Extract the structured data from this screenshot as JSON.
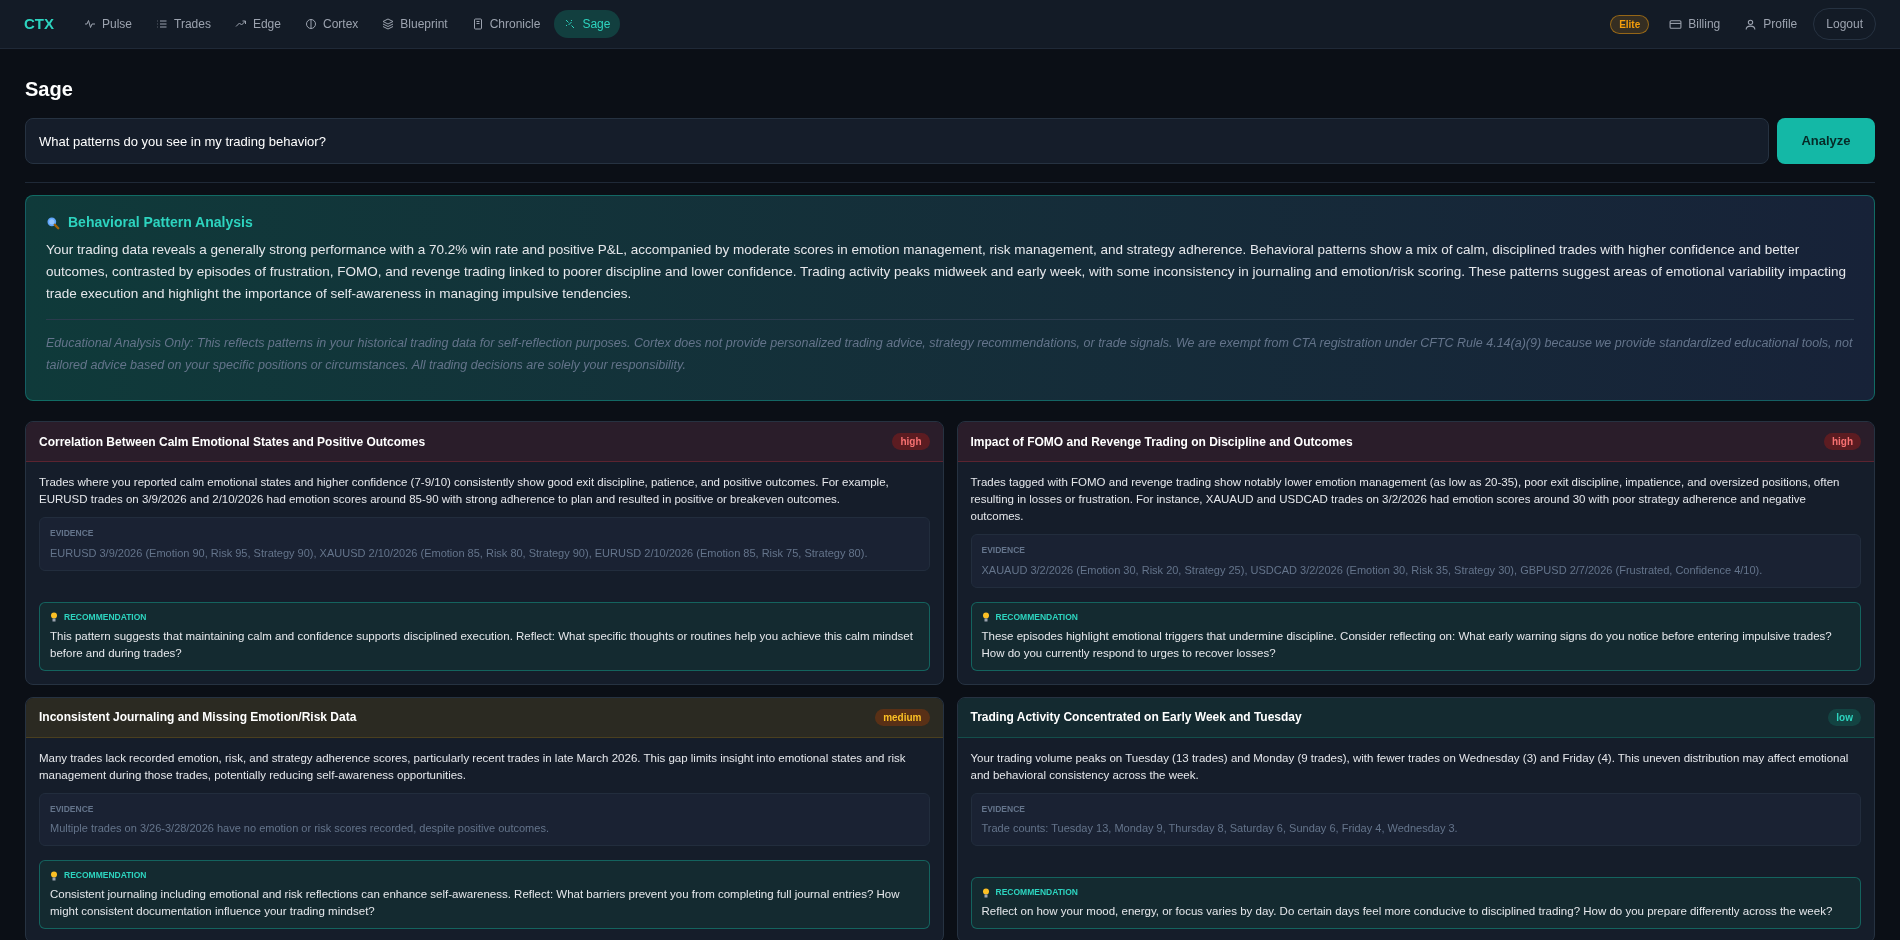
{
  "nav": {
    "logo": "CTX",
    "items": [
      {
        "label": "Pulse",
        "kind": "pulse",
        "selected": false
      },
      {
        "label": "Trades",
        "kind": "list",
        "selected": false
      },
      {
        "label": "Edge",
        "kind": "trend",
        "selected": false
      },
      {
        "label": "Cortex",
        "kind": "brain",
        "selected": false
      },
      {
        "label": "Blueprint",
        "kind": "layers",
        "selected": false
      },
      {
        "label": "Chronicle",
        "kind": "notebook",
        "selected": false
      },
      {
        "label": "Sage",
        "kind": "sparkle",
        "selected": true
      }
    ],
    "plan_badge": "Elite",
    "billing": "Billing",
    "profile": "Profile",
    "logout": "Logout"
  },
  "page_title": "Sage",
  "query": {
    "value": "What patterns do you see in my trading behavior?",
    "button": "Analyze"
  },
  "analysis": {
    "title": "Behavioral Pattern Analysis",
    "summary": "Your trading data reveals a generally strong performance with a 70.2% win rate and positive P&L, accompanied by moderate scores in emotion management, risk management, and strategy adherence. Behavioral patterns show a mix of calm, disciplined trades with higher confidence and better outcomes, contrasted by episodes of frustration, FOMO, and revenge trading linked to poorer discipline and lower confidence. Trading activity peaks midweek and early week, with some inconsistency in journaling and emotion/risk scoring. These patterns suggest areas of emotional variability impacting trade execution and highlight the importance of self-awareness in managing impulsive tendencies.",
    "disclaimer": "Educational Analysis Only: This reflects patterns in your historical trading data for self-reflection purposes. Cortex does not provide personalized trading advice, strategy recommendations, or trade signals. We are exempt from CTA registration under CFTC Rule 4.14(a)(9) because we provide standardized educational tools, not tailored advice based on your specific positions or circumstances. All trading decisions are solely your responsibility."
  },
  "patterns": [
    {
      "title": "Correlation Between Calm Emotional States and Positive Outcomes",
      "severity": "high",
      "description": "Trades where you reported calm emotional states and higher confidence (7-9/10) consistently show good exit discipline, patience, and positive outcomes. For example, EURUSD trades on 3/9/2026 and 2/10/2026 had emotion scores around 85-90 with strong adherence to plan and resulted in positive or breakeven outcomes.",
      "evidence_label": "EVIDENCE",
      "evidence": "EURUSD 3/9/2026 (Emotion 90, Risk 95, Strategy 90), XAUUSD 2/10/2026 (Emotion 85, Risk 80, Strategy 90), EURUSD 2/10/2026 (Emotion 85, Risk 75, Strategy 80).",
      "recommendation_label": "RECOMMENDATION",
      "recommendation": "This pattern suggests that maintaining calm and confidence supports disciplined execution. Reflect: What specific thoughts or routines help you achieve this calm mindset before and during trades?"
    },
    {
      "title": "Impact of FOMO and Revenge Trading on Discipline and Outcomes",
      "severity": "high",
      "description": "Trades tagged with FOMO and revenge trading show notably lower emotion management (as low as 20-35), poor exit discipline, impatience, and oversized positions, often resulting in losses or frustration. For instance, XAUAUD and USDCAD trades on 3/2/2026 had emotion scores around 30 with poor strategy adherence and negative outcomes.",
      "evidence_label": "EVIDENCE",
      "evidence": "XAUAUD 3/2/2026 (Emotion 30, Risk 20, Strategy 25), USDCAD 3/2/2026 (Emotion 30, Risk 35, Strategy 30), GBPUSD 2/7/2026 (Frustrated, Confidence 4/10).",
      "recommendation_label": "RECOMMENDATION",
      "recommendation": "These episodes highlight emotional triggers that undermine discipline. Consider reflecting on: What early warning signs do you notice before entering impulsive trades? How do you currently respond to urges to recover losses?"
    },
    {
      "title": "Inconsistent Journaling and Missing Emotion/Risk Data",
      "severity": "medium",
      "description": "Many trades lack recorded emotion, risk, and strategy adherence scores, particularly recent trades in late March 2026. This gap limits insight into emotional states and risk management during those trades, potentially reducing self-awareness opportunities.",
      "evidence_label": "EVIDENCE",
      "evidence": "Multiple trades on 3/26-3/28/2026 have no emotion or risk scores recorded, despite positive outcomes.",
      "recommendation_label": "RECOMMENDATION",
      "recommendation": "Consistent journaling including emotional and risk reflections can enhance self-awareness. Reflect: What barriers prevent you from completing full journal entries? How might consistent documentation influence your trading mindset?"
    },
    {
      "title": "Trading Activity Concentrated on Early Week and Tuesday",
      "severity": "low",
      "description": "Your trading volume peaks on Tuesday (13 trades) and Monday (9 trades), with fewer trades on Wednesday (3) and Friday (4). This uneven distribution may affect emotional and behavioral consistency across the week.",
      "evidence_label": "EVIDENCE",
      "evidence": "Trade counts: Tuesday 13, Monday 9, Thursday 8, Saturday 6, Sunday 6, Friday 4, Wednesday 3.",
      "recommendation_label": "RECOMMENDATION",
      "recommendation": "Reflect on how your mood, energy, or focus varies by day. Do certain days feel more conducive to disciplined trading? How do you prepare differently across the week?"
    }
  ]
}
